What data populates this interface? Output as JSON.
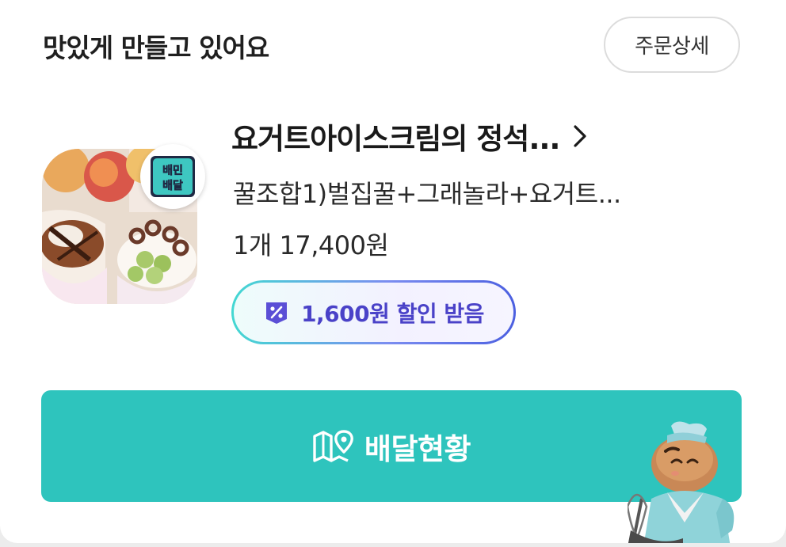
{
  "status": {
    "title": "맛있게 만들고 있어요"
  },
  "header": {
    "detail_button": "주문상세"
  },
  "store": {
    "name": "요거트아이스크림의 정석...",
    "badge_line1": "배민",
    "badge_line2": "배달"
  },
  "order": {
    "menu": "꿀조합1)벌집꿀+그래놀라+요거트...",
    "qty_price": "1개 17,400원"
  },
  "discount": {
    "label": "1,600원 할인 받음",
    "icon": "discount-coupon-icon"
  },
  "track": {
    "label": "배달현황",
    "icon": "map-pin-icon"
  },
  "colors": {
    "accent": "#2ec4bd",
    "discount_text": "#4a42c8",
    "title": "#1f1f1f"
  }
}
